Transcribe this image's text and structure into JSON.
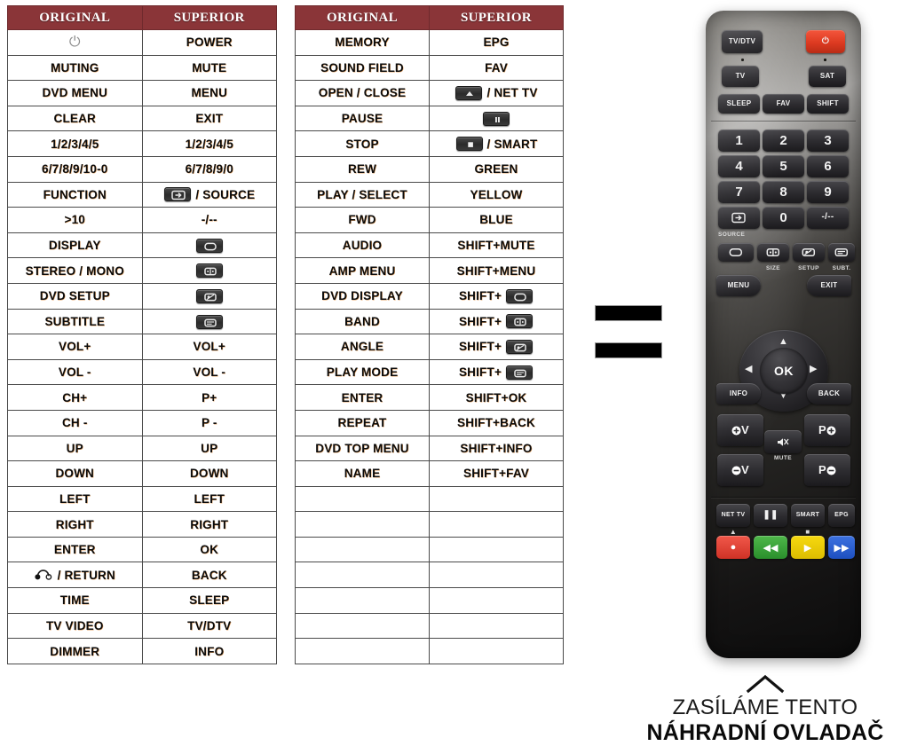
{
  "tables": {
    "headers": {
      "original": "ORIGINAL",
      "superior": "SUPERIOR"
    },
    "left_rows": [
      {
        "original": "",
        "original_icon": "power-icon",
        "superior": "POWER"
      },
      {
        "original": "MUTING",
        "superior": "MUTE"
      },
      {
        "original": "DVD MENU",
        "superior": "MENU"
      },
      {
        "original": "CLEAR",
        "superior": "EXIT"
      },
      {
        "original": "1/2/3/4/5",
        "superior": "1/2/3/4/5"
      },
      {
        "original": "6/7/8/9/10-0",
        "superior": "6/7/8/9/0"
      },
      {
        "original": "FUNCTION",
        "superior": "/ SOURCE",
        "superior_icon": "source-key-icon"
      },
      {
        "original": ">10",
        "superior": "-/--"
      },
      {
        "original": "DISPLAY",
        "superior": "",
        "superior_icon": "display-key-icon"
      },
      {
        "original": "STEREO / MONO",
        "superior": "",
        "superior_icon": "size-key-icon"
      },
      {
        "original": "DVD SETUP",
        "superior": "",
        "superior_icon": "setup-key-icon"
      },
      {
        "original": "SUBTITLE",
        "superior": "",
        "superior_icon": "subtitle-key-icon"
      },
      {
        "original": "VOL+",
        "superior": "VOL+"
      },
      {
        "original": "VOL -",
        "superior": "VOL -"
      },
      {
        "original": "CH+",
        "superior": "P+"
      },
      {
        "original": "CH -",
        "superior": "P -"
      },
      {
        "original": "UP",
        "superior": "UP"
      },
      {
        "original": "DOWN",
        "superior": "DOWN"
      },
      {
        "original": "LEFT",
        "superior": "LEFT"
      },
      {
        "original": "RIGHT",
        "superior": "RIGHT"
      },
      {
        "original": "ENTER",
        "superior": "OK"
      },
      {
        "original": "/ RETURN",
        "original_icon": "headphones-icon",
        "superior": "BACK"
      },
      {
        "original": "TIME",
        "superior": "SLEEP"
      },
      {
        "original": "TV VIDEO",
        "superior": "TV/DTV"
      },
      {
        "original": "DIMMER",
        "superior": "INFO"
      }
    ],
    "right_rows": [
      {
        "original": "MEMORY",
        "superior": "EPG"
      },
      {
        "original": "SOUND FIELD",
        "superior": "FAV"
      },
      {
        "original": "OPEN / CLOSE",
        "superior": "/ NET TV",
        "superior_icon": "eject-key-icon"
      },
      {
        "original": "PAUSE",
        "superior": "",
        "superior_icon": "pause-key-icon"
      },
      {
        "original": "STOP",
        "superior": "/ SMART",
        "superior_icon": "stop-key-icon"
      },
      {
        "original": "REW",
        "superior": "GREEN"
      },
      {
        "original": "PLAY / SELECT",
        "superior": "YELLOW"
      },
      {
        "original": "FWD",
        "superior": "BLUE"
      },
      {
        "original": "AUDIO",
        "superior": "SHIFT+MUTE"
      },
      {
        "original": "AMP MENU",
        "superior": "SHIFT+MENU"
      },
      {
        "original": "DVD DISPLAY",
        "superior": "SHIFT+",
        "superior_icon": "display-key-icon"
      },
      {
        "original": "BAND",
        "superior": "SHIFT+",
        "superior_icon": "size-key-icon"
      },
      {
        "original": "ANGLE",
        "superior": "SHIFT+",
        "superior_icon": "setup-key-icon"
      },
      {
        "original": "PLAY MODE",
        "superior": "SHIFT+",
        "superior_icon": "subtitle-key-icon"
      },
      {
        "original": "ENTER",
        "superior": "SHIFT+OK"
      },
      {
        "original": "REPEAT",
        "superior": "SHIFT+BACK"
      },
      {
        "original": "DVD TOP MENU",
        "superior": "SHIFT+INFO"
      },
      {
        "original": "NAME",
        "superior": "SHIFT+FAV"
      },
      {
        "original": "",
        "superior": ""
      },
      {
        "original": "",
        "superior": ""
      },
      {
        "original": "",
        "superior": ""
      },
      {
        "original": "",
        "superior": ""
      },
      {
        "original": "",
        "superior": ""
      },
      {
        "original": "",
        "superior": ""
      },
      {
        "original": "",
        "superior": ""
      }
    ]
  },
  "redactions": [
    {
      "name": "redaction-bar-1"
    },
    {
      "name": "redaction-bar-2"
    }
  ],
  "remote": {
    "buttons": {
      "tv_dtv": "TV/DTV",
      "power": "⏻",
      "tv": "TV",
      "sat": "SAT",
      "sleep": "SLEEP",
      "fav": "FAV",
      "shift": "SHIFT",
      "n1": "1",
      "n2": "2",
      "n3": "3",
      "n4": "4",
      "n5": "5",
      "n6": "6",
      "n7": "7",
      "n8": "8",
      "n9": "9",
      "n0": "0",
      "dash": "-/--",
      "source_label": "SOURCE",
      "size_label": "SIZE",
      "setup_label": "SETUP",
      "subt_label": "SUBT.",
      "menu": "MENU",
      "exit": "EXIT",
      "ok": "OK",
      "info": "INFO",
      "back": "BACK",
      "vol_up": "+V",
      "vol_down": "-V",
      "prog_up": "P+",
      "prog_down": "P-",
      "mute_label": "MUTE",
      "net_tv": "NET TV",
      "pause": "❚❚",
      "smart": "SMART",
      "epg": "EPG"
    },
    "colors": {
      "power_red": "#dd3a21",
      "red": "#cf3226",
      "green": "#2a8f2c",
      "yellow": "#ddbd00",
      "blue": "#1d4fc0"
    }
  },
  "caption": {
    "line1": "ZASÍLÁME TENTO",
    "line2": "NÁHRADNÍ OVLADAČ"
  },
  "theme": {
    "header_bg": "#8a3538",
    "header_text": "#ffffff",
    "border": "#4a4a4a",
    "page_bg": "#ffffff"
  }
}
